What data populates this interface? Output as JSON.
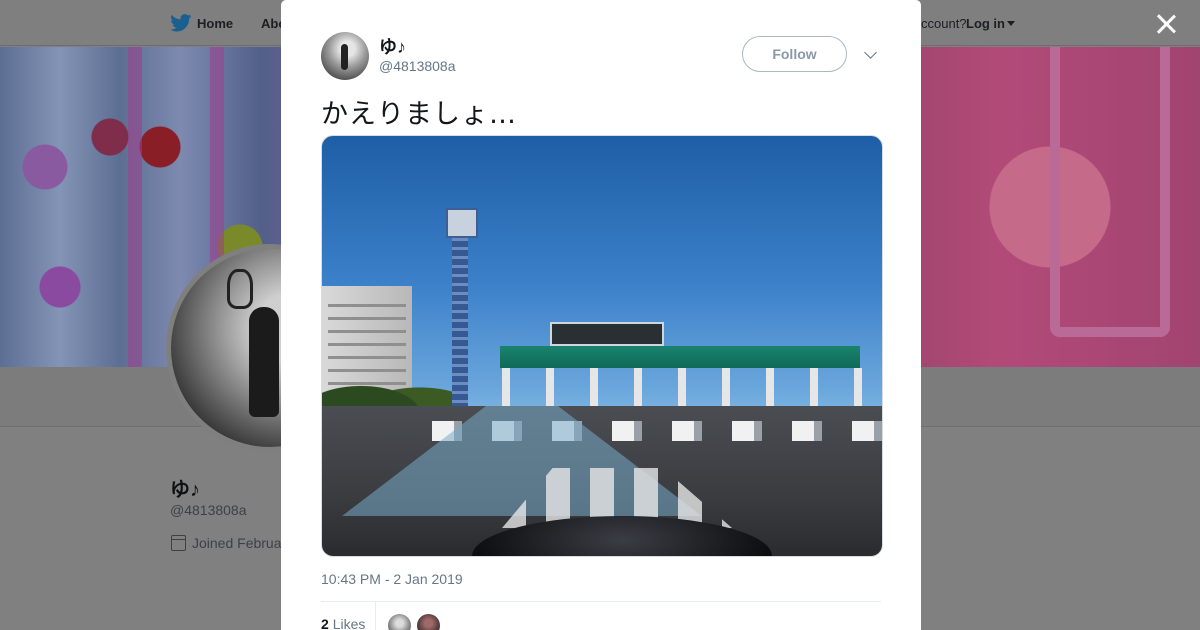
{
  "topbar": {
    "home_label": "Home",
    "about_label": "Abo",
    "have_account_label": "ccount?",
    "login_label": "Log in"
  },
  "profile": {
    "name": "ゆ♪",
    "handle": "@4813808a",
    "joined": "Joined Februa"
  },
  "tweet": {
    "author_name": "ゆ♪",
    "author_handle": "@4813808a",
    "follow_label": "Follow",
    "text": "かえりましょ…",
    "timestamp": "10:43 PM - 2 Jan 2019",
    "likes_count": "2",
    "likes_label": "Likes"
  },
  "colors": {
    "twitter_blue": "#1da1f2",
    "overlay_gray": "#808080",
    "meta_gray": "#657786"
  }
}
